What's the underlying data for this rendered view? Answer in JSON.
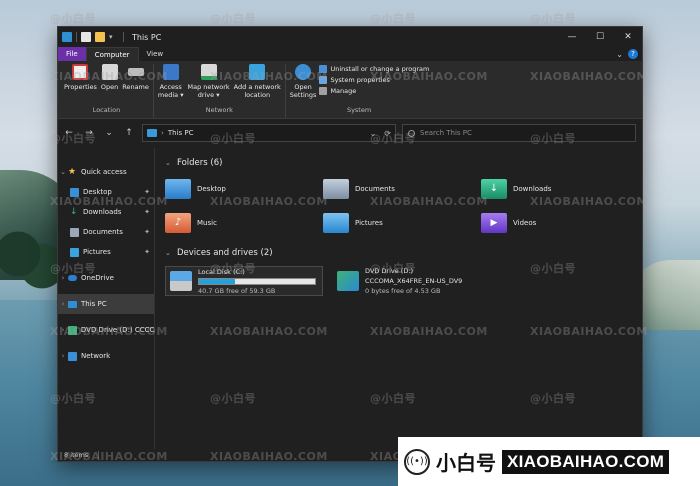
{
  "window": {
    "title": "This PC",
    "controls": {
      "minimize": "—",
      "maximize": "☐",
      "close": "✕"
    }
  },
  "ribbon_tabs": {
    "file": "File",
    "computer": "Computer",
    "view": "View",
    "collapse": "⌄",
    "help": "?"
  },
  "ribbon": {
    "location": {
      "label": "Location",
      "properties": "Properties",
      "open": "Open",
      "rename": "Rename"
    },
    "network": {
      "label": "Network",
      "access_media": "Access\nmedia ▾",
      "map_drive": "Map network\ndrive ▾",
      "add_location": "Add a network\nlocation"
    },
    "system": {
      "label": "System",
      "open_settings": "Open\nSettings",
      "uninstall": "Uninstall or change a program",
      "properties": "System properties",
      "manage": "Manage"
    }
  },
  "nav": {
    "back": "←",
    "forward": "→",
    "recent": "⌄",
    "up": "↑",
    "address": "This PC",
    "dropdown": "⌄",
    "refresh": "⟳",
    "search_placeholder": "Search This PC"
  },
  "sidebar": {
    "quick_access": "Quick access",
    "desktop": "Desktop",
    "downloads": "Downloads",
    "documents": "Documents",
    "pictures": "Pictures",
    "onedrive": "OneDrive",
    "this_pc": "This PC",
    "dvd": "DVD Drive (D:) CCCC",
    "network": "Network",
    "pin": "✦"
  },
  "folders": {
    "heading": "Folders (6)",
    "items": [
      "Desktop",
      "Documents",
      "Downloads",
      "Music",
      "Pictures",
      "Videos"
    ]
  },
  "drives": {
    "heading": "Devices and drives (2)",
    "c": {
      "name": "Local Disk (C:)",
      "free": "40.7 GB free of 59.3 GB",
      "used_fraction": 0.31
    },
    "d": {
      "name": "DVD Drive (D:)",
      "label": "CCCOMA_X64FRE_EN-US_DV9",
      "free": "0 bytes free of 4.53 GB"
    }
  },
  "status": {
    "items": "8 items"
  },
  "watermark": {
    "text": "XIAOBAIHAO.COM",
    "cn": "@小白号",
    "banner_cn": "小白号",
    "banner_en": "XIAOBAIHAO.COM"
  },
  "colors": {
    "file_tab": "#6b2fa8",
    "accent": "#26a0da",
    "folder_blue": "#3a8fd6",
    "downloads_green": "#1fa37a",
    "music_orange": "#e8734a",
    "videos_purple": "#7b4bd6"
  }
}
